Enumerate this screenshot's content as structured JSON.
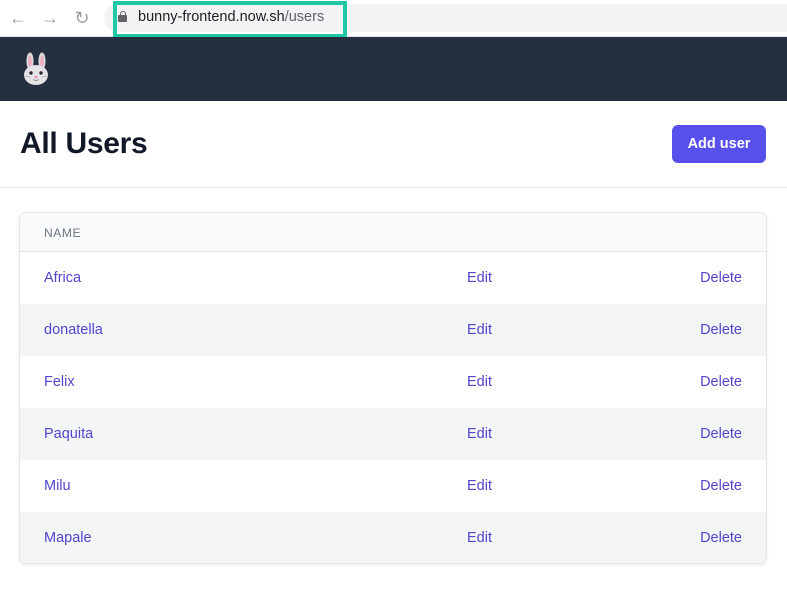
{
  "browser": {
    "url_host": "bunny-frontend.now.sh",
    "url_path": "/users",
    "back_icon": "←",
    "forward_icon": "→",
    "reload_icon": "↻"
  },
  "header": {
    "logo_icon": "rabbit-face-icon"
  },
  "page": {
    "title": "All Users",
    "add_button_label": "Add user"
  },
  "table": {
    "column_name": "NAME",
    "rows": [
      {
        "name": "Africa",
        "edit": "Edit",
        "delete": "Delete"
      },
      {
        "name": "donatella",
        "edit": "Edit",
        "delete": "Delete"
      },
      {
        "name": "Felix",
        "edit": "Edit",
        "delete": "Delete"
      },
      {
        "name": "Paquita",
        "edit": "Edit",
        "delete": "Delete"
      },
      {
        "name": "Milu",
        "edit": "Edit",
        "delete": "Delete"
      },
      {
        "name": "Mapale",
        "edit": "Edit",
        "delete": "Delete"
      }
    ]
  },
  "colors": {
    "header_bg": "#252f3f",
    "accent": "#5850ec",
    "link": "#5145cd",
    "highlight_border": "#1ec8a5"
  }
}
